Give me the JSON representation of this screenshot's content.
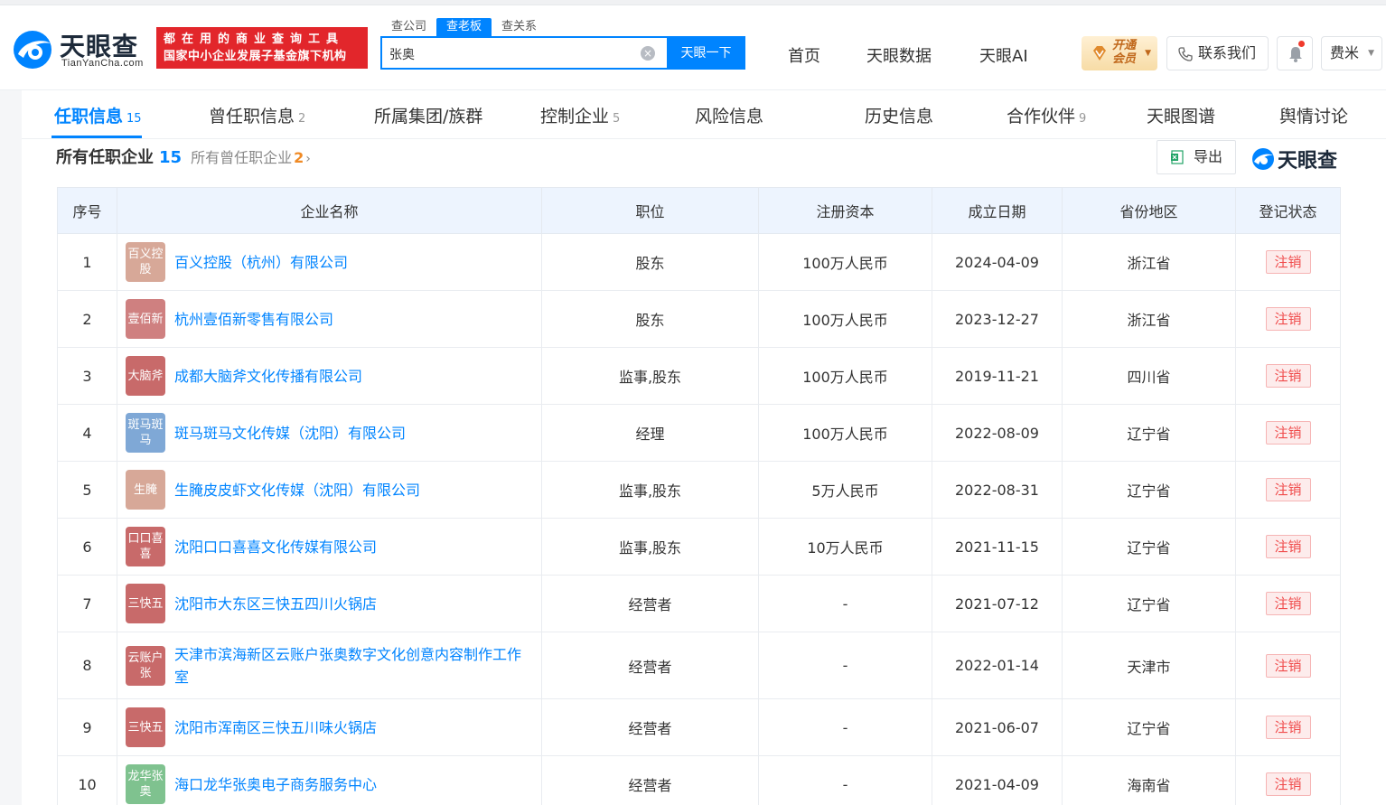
{
  "header": {
    "logo_text": "天眼查",
    "logo_sub": "TianYanCha.com",
    "slogan_line1": "都在用的商业查询工具",
    "slogan_line2": "国家中小企业发展子基金旗下机构",
    "search_tabs": [
      "查公司",
      "查老板",
      "查关系"
    ],
    "search_value": "张奥",
    "search_button": "天眼一下",
    "nav": [
      "首页",
      "天眼数据",
      "天眼AI"
    ],
    "vip_line1": "开通",
    "vip_line2": "会员",
    "contact_label": "联系我们",
    "user_name": "费米"
  },
  "tabs": [
    {
      "label": "任职信息",
      "count": "15"
    },
    {
      "label": "曾任职信息",
      "count": "2"
    },
    {
      "label": "所属集团/族群",
      "count": ""
    },
    {
      "label": "控制企业",
      "count": "5"
    },
    {
      "label": "风险信息",
      "count": ""
    },
    {
      "label": "历史信息",
      "count": ""
    },
    {
      "label": "合作伙伴",
      "count": "9"
    },
    {
      "label": "天眼图谱",
      "count": ""
    },
    {
      "label": "舆情讨论",
      "count": ""
    }
  ],
  "subhead": {
    "title": "所有任职企业",
    "count": "15",
    "link": "所有曾任职企业",
    "link_count": "2",
    "export_label": "导出",
    "brand": "天眼查"
  },
  "table": {
    "headers": [
      "序号",
      "企业名称",
      "职位",
      "注册资本",
      "成立日期",
      "省份地区",
      "登记状态"
    ],
    "rows": [
      {
        "no": "1",
        "avatar": "百义控股",
        "avatar_color": "#d7a898",
        "name": "百义控股（杭州）有限公司",
        "role": "股东",
        "capital": "100万人民币",
        "date": "2024-04-09",
        "region": "浙江省",
        "status": "注销"
      },
      {
        "no": "2",
        "avatar": "壹佰新",
        "avatar_color": "#cf8080",
        "name": "杭州壹佰新零售有限公司",
        "role": "股东",
        "capital": "100万人民币",
        "date": "2023-12-27",
        "region": "浙江省",
        "status": "注销"
      },
      {
        "no": "3",
        "avatar": "大脑斧",
        "avatar_color": "#c86a6a",
        "name": "成都大脑斧文化传播有限公司",
        "role": "监事,股东",
        "capital": "100万人民币",
        "date": "2019-11-21",
        "region": "四川省",
        "status": "注销"
      },
      {
        "no": "4",
        "avatar": "斑马斑马",
        "avatar_color": "#7fa8d6",
        "name": "斑马斑马文化传媒（沈阳）有限公司",
        "role": "经理",
        "capital": "100万人民币",
        "date": "2022-08-09",
        "region": "辽宁省",
        "status": "注销"
      },
      {
        "no": "5",
        "avatar": "生腌",
        "avatar_color": "#d7a898",
        "name": "生腌皮皮虾文化传媒（沈阳）有限公司",
        "role": "监事,股东",
        "capital": "5万人民币",
        "date": "2022-08-31",
        "region": "辽宁省",
        "status": "注销"
      },
      {
        "no": "6",
        "avatar": "口口喜喜",
        "avatar_color": "#c86a6a",
        "name": "沈阳口口喜喜文化传媒有限公司",
        "role": "监事,股东",
        "capital": "10万人民币",
        "date": "2021-11-15",
        "region": "辽宁省",
        "status": "注销"
      },
      {
        "no": "7",
        "avatar": "三快五",
        "avatar_color": "#c86a6a",
        "name": "沈阳市大东区三快五四川火锅店",
        "role": "经营者",
        "capital": "-",
        "date": "2021-07-12",
        "region": "辽宁省",
        "status": "注销"
      },
      {
        "no": "8",
        "avatar": "云账户张",
        "avatar_color": "#c86a6a",
        "name": "天津市滨海新区云账户张奥数字文化创意内容制作工作室",
        "role": "经营者",
        "capital": "-",
        "date": "2022-01-14",
        "region": "天津市",
        "status": "注销"
      },
      {
        "no": "9",
        "avatar": "三快五",
        "avatar_color": "#c86a6a",
        "name": "沈阳市浑南区三快五川味火锅店",
        "role": "经营者",
        "capital": "-",
        "date": "2021-06-07",
        "region": "辽宁省",
        "status": "注销"
      },
      {
        "no": "10",
        "avatar": "龙华张奥",
        "avatar_color": "#7fc28f",
        "name": "海口龙华张奥电子商务服务中心",
        "role": "经营者",
        "capital": "-",
        "date": "2021-04-09",
        "region": "海南省",
        "status": "注销"
      }
    ]
  },
  "colors": {
    "accent": "#0084ff",
    "slogan_bg": "#e2262b",
    "status_red": "#f04c4c"
  }
}
